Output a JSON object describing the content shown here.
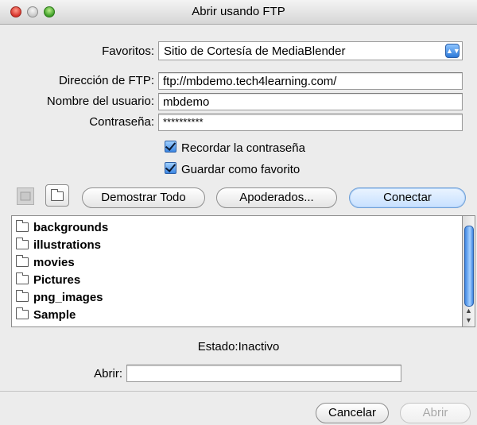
{
  "window": {
    "title": "Abrir usando FTP"
  },
  "form": {
    "favorites_label": "Favoritos:",
    "favorites_value": "Sitio de Cortesía de MediaBlender",
    "ftp_address_label": "Dirección de FTP:",
    "ftp_address_value": "ftp://mbdemo.tech4learning.com/",
    "username_label": "Nombre del usuario:",
    "username_value": "mbdemo",
    "password_label": "Contraseña:",
    "password_value": "**********",
    "remember_password_label": "Recordar la contraseña",
    "remember_password_checked": true,
    "save_favorite_label": "Guardar como favorito",
    "save_favorite_checked": true
  },
  "toolbar": {
    "show_all_label": "Demostrar Todo",
    "proxies_label": "Apoderados...",
    "connect_label": "Conectar"
  },
  "files": [
    {
      "name": "backgrounds"
    },
    {
      "name": "illustrations"
    },
    {
      "name": "movies"
    },
    {
      "name": "Pictures"
    },
    {
      "name": "png_images"
    },
    {
      "name": "Sample"
    }
  ],
  "status": {
    "text": "Estado:Inactivo"
  },
  "open_field": {
    "label": "Abrir:",
    "value": ""
  },
  "footer": {
    "cancel_label": "Cancelar",
    "open_label": "Abrir"
  },
  "colors": {
    "accent": "#3d87e3",
    "close": "#d6322a",
    "zoom": "#3d9d27"
  }
}
